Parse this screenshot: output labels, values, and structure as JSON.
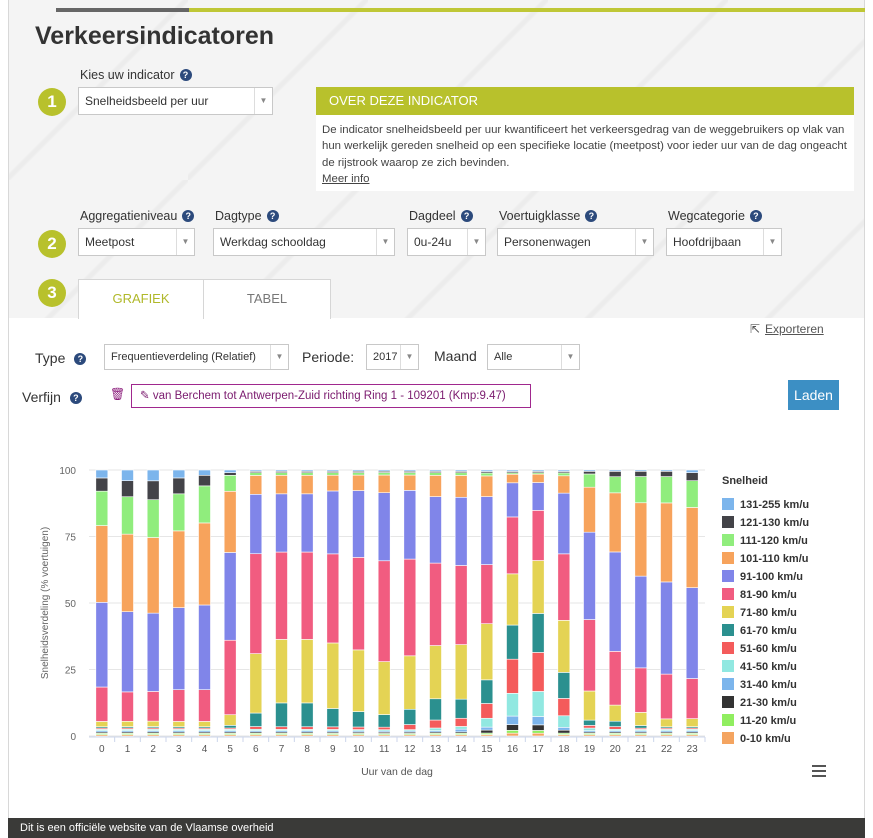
{
  "page": {
    "title": "Verkeersindicatoren",
    "steps": [
      "1",
      "2",
      "3"
    ],
    "footer": "Dit is een officiële website van de Vlaamse overheid",
    "accent_color": "#b8c12c"
  },
  "indicator": {
    "label": "Kies uw indicator",
    "value": "Snelheidsbeeld per uur"
  },
  "about": {
    "title": "OVER DEZE INDICATOR",
    "text": "De indicator snelheidsbeeld per uur kwantificeert het verkeersgedrag van de weggebruikers op vlak van hun werkelijk gereden snelheid op een specifieke locatie (meetpost) voor ieder uur van de dag ongeacht de rijstrook waarop ze zich bevinden.",
    "link": "Meer info"
  },
  "filters": {
    "aggregatie": {
      "label": "Aggregatieniveau",
      "value": "Meetpost"
    },
    "dagtype": {
      "label": "Dagtype",
      "value": "Werkdag schooldag"
    },
    "dagdeel": {
      "label": "Dagdeel",
      "value": "0u-24u"
    },
    "voertuigklasse": {
      "label": "Voertuigklasse",
      "value": "Personenwagen"
    },
    "wegcategorie": {
      "label": "Wegcategorie",
      "value": "Hoofdrijbaan"
    }
  },
  "tabs": {
    "grafiek": "GRAFIEK",
    "tabel": "TABEL"
  },
  "controls": {
    "export": "Exporteren",
    "type_label": "Type",
    "type_value": "Frequentieverdeling (Relatief)",
    "periode_label": "Periode:",
    "periode_value": "2017",
    "maand_label": "Maand",
    "maand_value": "Alle",
    "verfijn_label": "Verfijn",
    "filter_chip": "van Berchem tot Antwerpen-Zuid richting Ring 1 - 109201 (Kmp:9.47)",
    "load_button": "Laden"
  },
  "chart_data": {
    "type": "bar",
    "stacked": true,
    "xlabel": "Uur van de dag",
    "ylabel": "Snelheidsverdeling (% voertuigen)",
    "ylim": [
      0,
      100
    ],
    "yticks": [
      0,
      25,
      50,
      75,
      100
    ],
    "legend_title": "Snelheid",
    "legend_position": "right",
    "categories": [
      "0",
      "1",
      "2",
      "3",
      "4",
      "5",
      "6",
      "7",
      "8",
      "9",
      "10",
      "11",
      "12",
      "13",
      "14",
      "15",
      "16",
      "17",
      "18",
      "19",
      "20",
      "21",
      "22",
      "23"
    ],
    "series": [
      {
        "name": "0-10 km/u",
        "color": "#f4a460",
        "values": [
          0.5,
          0.5,
          0.5,
          0.5,
          0.5,
          0.5,
          0.5,
          0.5,
          0.5,
          0.5,
          0.5,
          0.5,
          0.5,
          0.5,
          0.5,
          0.5,
          1,
          1,
          0.5,
          0.5,
          0.5,
          0.5,
          0.5,
          0.5
        ]
      },
      {
        "name": "11-20 km/u",
        "color": "#90ee60",
        "values": [
          0.5,
          0.5,
          0.5,
          0.5,
          0.5,
          0.5,
          0.5,
          0.5,
          0.5,
          0.5,
          0.5,
          0.5,
          0.5,
          0.5,
          0.5,
          0.5,
          1,
          1,
          0.5,
          0.5,
          0.5,
          0.5,
          0.5,
          0.5
        ]
      },
      {
        "name": "21-30 km/u",
        "color": "#333333",
        "values": [
          0.5,
          0.5,
          0.5,
          0.5,
          0.5,
          0.5,
          0.5,
          0.5,
          0.5,
          0.5,
          0.5,
          0.5,
          0.5,
          0.5,
          0.5,
          1,
          2,
          2,
          1,
          0.5,
          0.5,
          0.5,
          0.5,
          0.5
        ]
      },
      {
        "name": "31-40 km/u",
        "color": "#7cb5ec",
        "values": [
          0.5,
          0.5,
          0.5,
          0.5,
          0.5,
          0.5,
          0.5,
          0.5,
          0.5,
          0.5,
          0.5,
          0.5,
          0.5,
          0.5,
          1,
          1,
          3,
          3,
          1,
          0.5,
          0.5,
          0.5,
          0.5,
          0.5
        ]
      },
      {
        "name": "41-50 km/u",
        "color": "#91e8e1",
        "values": [
          0.5,
          0.5,
          0.5,
          0.5,
          0.5,
          0.5,
          0.5,
          0.5,
          0.5,
          0.5,
          0.5,
          0.5,
          0.5,
          1,
          1,
          3,
          8,
          9,
          4,
          1,
          0.5,
          0.5,
          0.5,
          0.5
        ]
      },
      {
        "name": "51-60 km/u",
        "color": "#f45b5b",
        "values": [
          0.5,
          0.5,
          0.5,
          0.5,
          0.5,
          0.5,
          1,
          1,
          1,
          1,
          1,
          1,
          2,
          3,
          3,
          5,
          12,
          14,
          6,
          1,
          1,
          0.5,
          0.5,
          0.5
        ]
      },
      {
        "name": "61-70 km/u",
        "color": "#2b908f",
        "values": [
          0.5,
          0.5,
          0.5,
          0.5,
          0.5,
          1,
          5,
          9,
          9,
          7,
          6,
          5,
          6,
          8,
          7,
          8,
          12,
          14,
          9,
          2,
          2,
          1,
          0.5,
          0.5
        ]
      },
      {
        "name": "71-80 km/u",
        "color": "#e4d354",
        "values": [
          2,
          2,
          2,
          2,
          2,
          4,
          22,
          24,
          24,
          25,
          24,
          21,
          21,
          20,
          20,
          19,
          18,
          19,
          18,
          11,
          6,
          5,
          3,
          3
        ]
      },
      {
        "name": "81-90 km/u",
        "color": "#f15c80",
        "values": [
          13,
          11,
          11,
          12,
          12,
          28,
          37,
          33,
          33,
          34,
          36,
          40,
          38,
          31,
          29,
          20,
          20,
          18,
          23,
          27,
          20,
          17,
          17,
          15
        ]
      },
      {
        "name": "91-100 km/u",
        "color": "#8085e9",
        "values": [
          32,
          30,
          29,
          31,
          32,
          33,
          22,
          22,
          22,
          24,
          26,
          27,
          27,
          25,
          25,
          23,
          12,
          10,
          21,
          33,
          37,
          35,
          35,
          34
        ]
      },
      {
        "name": "101-110 km/u",
        "color": "#f7a35c",
        "values": [
          29,
          29,
          28,
          29,
          31,
          23,
          7,
          7,
          7,
          6,
          6,
          7,
          6,
          8,
          8,
          7,
          3,
          3,
          6,
          17,
          22,
          28,
          30,
          30
        ]
      },
      {
        "name": "111-120 km/u",
        "color": "#90ed7d",
        "values": [
          13,
          14,
          14,
          14,
          14,
          6,
          1,
          1,
          1,
          1,
          1,
          1,
          1,
          1,
          1,
          1,
          0.5,
          0.5,
          1,
          5,
          6,
          10,
          10,
          10
        ]
      },
      {
        "name": "121-130 km/u",
        "color": "#434348",
        "values": [
          5,
          6,
          7,
          6,
          4,
          1,
          0.5,
          0.5,
          0.5,
          0.5,
          0.5,
          0.5,
          0.5,
          0.5,
          0.5,
          0.5,
          0.5,
          0.5,
          0.5,
          1,
          2,
          2,
          2,
          3
        ]
      },
      {
        "name": "131-255 km/u",
        "color": "#7cb5ec",
        "values": [
          3,
          4,
          4,
          3,
          2,
          1,
          0.5,
          0.5,
          0.5,
          0.5,
          0.5,
          0.5,
          0.5,
          0.5,
          0.5,
          0.5,
          0.5,
          0.5,
          0.5,
          0.5,
          0.5,
          0.5,
          0.5,
          1
        ]
      }
    ]
  }
}
